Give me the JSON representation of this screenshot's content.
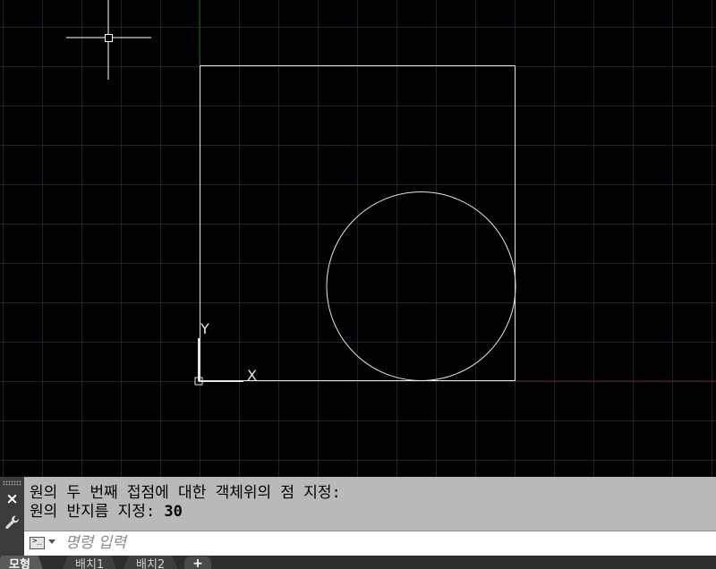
{
  "command_history": [
    {
      "text": "원의 두 번째 접점에 대한 객체위의 점 지정:",
      "value": ""
    },
    {
      "text": "원의 반지름 지정: ",
      "value": "30"
    }
  ],
  "command_input": {
    "placeholder": "명령 입력",
    "value": ""
  },
  "axis_labels": {
    "x": "X",
    "y": "Y"
  },
  "tabs": [
    {
      "label": "모형",
      "active": true
    },
    {
      "label": "배치1",
      "active": false
    },
    {
      "label": "배치2",
      "active": false
    }
  ],
  "tab_add_label": "+",
  "close_label": "×",
  "prompt_icon_label": ">_",
  "colors": {
    "background": "#000000",
    "grid": "#1c2130",
    "geometry": "#e6e6e6",
    "x_axis": "#6b1a1a",
    "y_axis": "#1a5c1a",
    "panel": "#b9b9b9"
  },
  "icons": {
    "close": "close-icon",
    "settings": "wrench-icon",
    "prompt": "command-prompt-icon",
    "dropdown": "chevron-down-icon"
  }
}
